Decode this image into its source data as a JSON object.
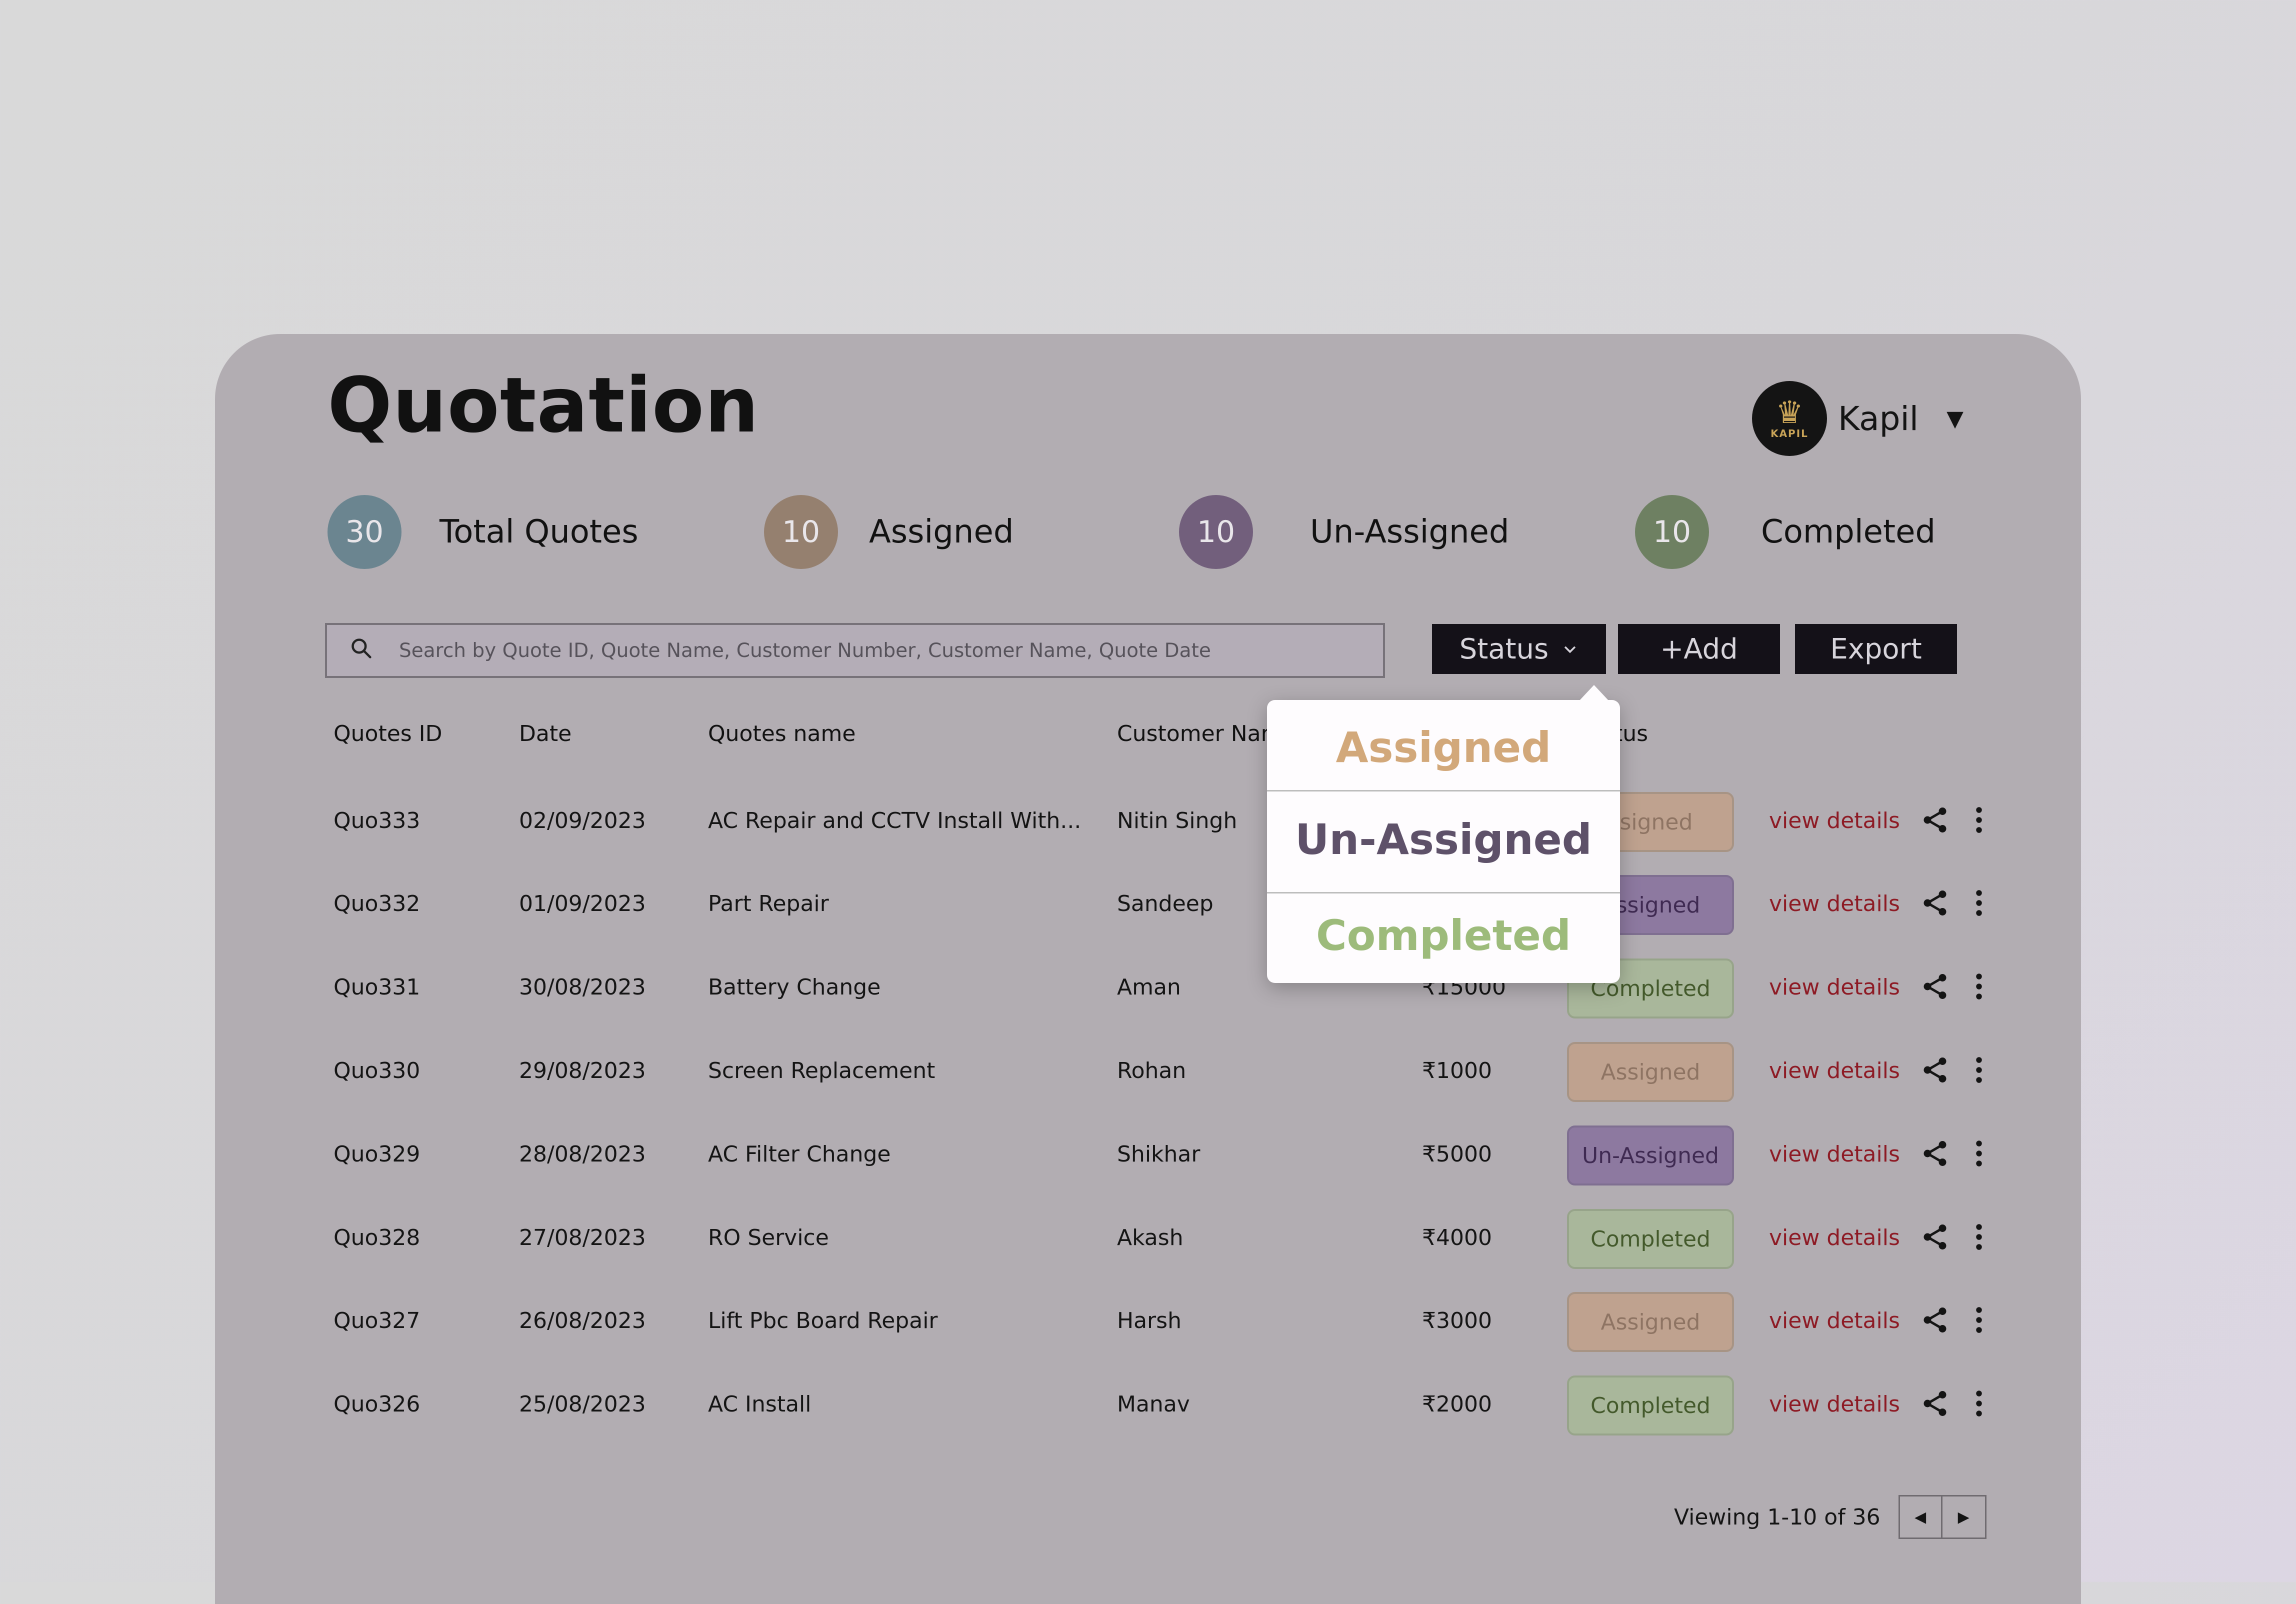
{
  "page": {
    "title": "Quotation"
  },
  "user": {
    "name": "Kapil",
    "logo_text": "KAPIL"
  },
  "stats": [
    {
      "count": "30",
      "label": "Total Quotes",
      "color": "#6b8590"
    },
    {
      "count": "10",
      "label": "Assigned",
      "color": "#95806f"
    },
    {
      "count": "10",
      "label": "Un-Assigned",
      "color": "#725f7c"
    },
    {
      "count": "10",
      "label": "Completed",
      "color": "#6e8062"
    }
  ],
  "search": {
    "placeholder": "Search by Quote ID, Quote Name, Customer Number, Customer Name, Quote Date"
  },
  "toolbar": {
    "status_label": "Status",
    "add_label": "+Add",
    "export_label": "Export"
  },
  "table": {
    "headers": [
      "Quotes ID",
      "Date",
      "Quotes name",
      "Customer Nam",
      "tus"
    ],
    "view_label": "view details",
    "rows": [
      {
        "id": "Quo333",
        "date": "02/09/2023",
        "name": "AC Repair and CCTV Install With...",
        "customer": "Nitin Singh",
        "amount": "",
        "status": "ssigned",
        "status_type": "assigned"
      },
      {
        "id": "Quo332",
        "date": "01/09/2023",
        "name": "Part Repair",
        "customer": "Sandeep",
        "amount": "",
        "status": "Assigned",
        "status_type": "unassigned"
      },
      {
        "id": "Quo331",
        "date": "30/08/2023",
        "name": "Battery Change",
        "customer": "Aman",
        "amount": "₹15000",
        "status": "Completed",
        "status_type": "completed"
      },
      {
        "id": "Quo330",
        "date": "29/08/2023",
        "name": "Screen Replacement",
        "customer": "Rohan",
        "amount": "₹1000",
        "status": "Assigned",
        "status_type": "assigned"
      },
      {
        "id": "Quo329",
        "date": "28/08/2023",
        "name": "AC Filter Change",
        "customer": "Shikhar",
        "amount": "₹5000",
        "status": "Un-Assigned",
        "status_type": "unassigned"
      },
      {
        "id": "Quo328",
        "date": "27/08/2023",
        "name": "RO Service",
        "customer": "Akash",
        "amount": "₹4000",
        "status": "Completed",
        "status_type": "completed"
      },
      {
        "id": "Quo327",
        "date": "26/08/2023",
        "name": "Lift Pbc Board Repair",
        "customer": "Harsh",
        "amount": "₹3000",
        "status": "Assigned",
        "status_type": "assigned"
      },
      {
        "id": "Quo326",
        "date": "25/08/2023",
        "name": "AC Install",
        "customer": "Manav",
        "amount": "₹2000",
        "status": "Completed",
        "status_type": "completed"
      }
    ]
  },
  "pagination": {
    "text": "Viewing 1-10 of 36",
    "prev": "◀",
    "next": "▶"
  },
  "dropdown": {
    "options": [
      {
        "label": "Assigned",
        "color": "#d2a87a"
      },
      {
        "label": "Un-Assigned",
        "color": "#5e5169"
      },
      {
        "label": "Completed",
        "color": "#9dbb7b"
      }
    ]
  },
  "icons": {
    "search": "search-icon",
    "share": "share-icon",
    "more": "more-vertical-icon",
    "caret": "caret-down-icon",
    "chevron": "chevron-down-icon"
  }
}
